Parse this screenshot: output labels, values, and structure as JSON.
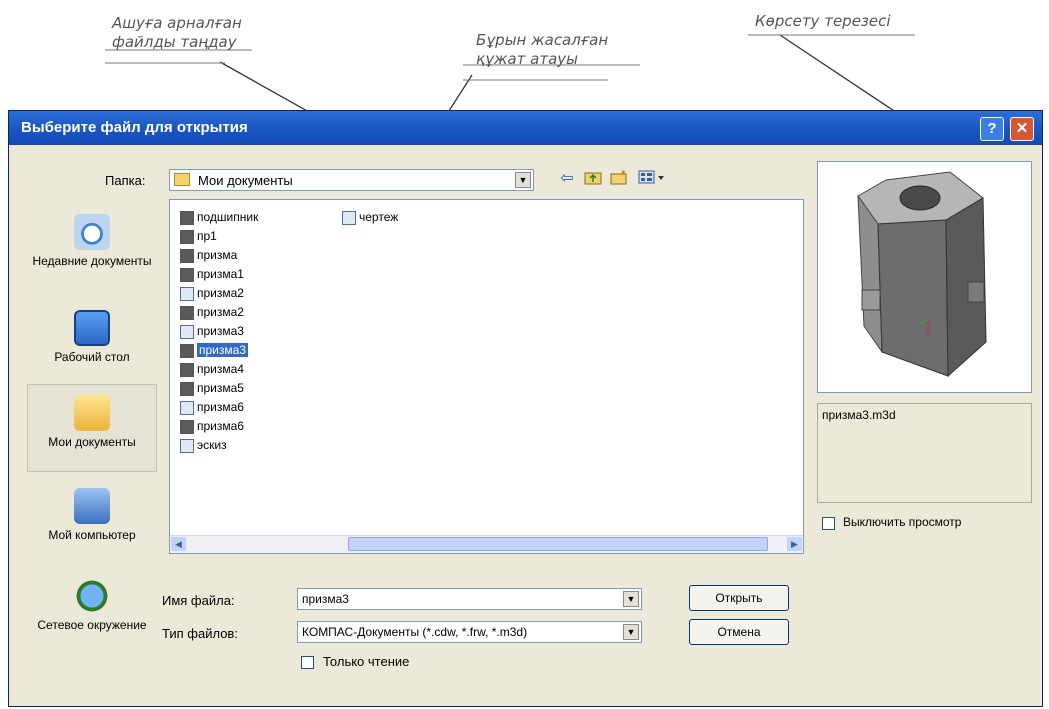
{
  "annotations": {
    "select_file": [
      "Ашуға арналған",
      "файлды таңдау"
    ],
    "created_file": [
      "Бұрын жасалған",
      "құжат атауы"
    ],
    "preview_window": "Көрсету терезесі"
  },
  "dialog": {
    "title": "Выберите файл для открытия",
    "help_label": "?",
    "close_label": "✕",
    "folder_label": "Папка:",
    "folder_value": "Мои документы",
    "places": [
      "Недавние документы",
      "Рабочий стол",
      "Мои документы",
      "Мой компьютер",
      "Сетевое окружение"
    ],
    "files": [
      {
        "name": "подшипник",
        "type": "part"
      },
      {
        "name": "пр1",
        "type": "part"
      },
      {
        "name": "призма",
        "type": "part"
      },
      {
        "name": "призма1",
        "type": "part"
      },
      {
        "name": "призма2",
        "type": "draw"
      },
      {
        "name": "призма2",
        "type": "part"
      },
      {
        "name": "призма3",
        "type": "draw"
      },
      {
        "name": "призма3",
        "type": "part",
        "selected": true
      },
      {
        "name": "призма4",
        "type": "part"
      },
      {
        "name": "призма5",
        "type": "part"
      },
      {
        "name": "призма6",
        "type": "draw"
      },
      {
        "name": "призма6",
        "type": "part"
      },
      {
        "name": "эскиз",
        "type": "draw"
      },
      {
        "name": "чертеж",
        "type": "draw"
      }
    ],
    "filename_label": "Имя файла:",
    "filename_value": "призма3",
    "filetype_label": "Тип файлов:",
    "filetype_value": "КОМПАС-Документы (*.cdw, *.frw, *.m3d)",
    "readonly_label": "Только чтение",
    "open_button": "Открыть",
    "cancel_button": "Отмена",
    "preview_filename": "призма3.m3d",
    "disable_preview_label": "Выключить просмотр"
  }
}
